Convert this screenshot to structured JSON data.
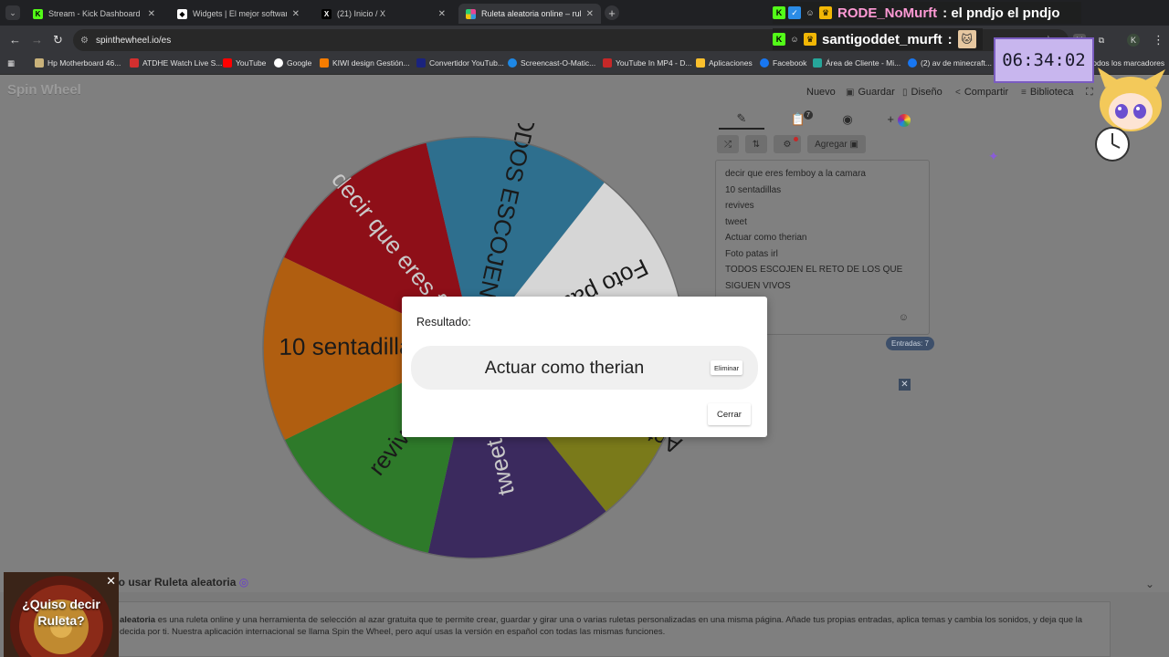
{
  "tabs": [
    {
      "title": "Stream - Kick Dashboard",
      "icon": "kick-icon",
      "badge": "K",
      "color": "#53fc18"
    },
    {
      "title": "Widgets | El mejor software para",
      "icon": "streamelements-icon",
      "badge": "◆",
      "color": "#ffffff"
    },
    {
      "title": "(21) Inicio / X",
      "icon": "x-icon",
      "badge": "X",
      "color": "#ffffff"
    },
    {
      "title": "Ruleta aleatoria online – ruleta",
      "icon": "spinthewheel-icon",
      "badge": "",
      "color": "#e84393"
    }
  ],
  "url": "spinthewheel.io/es",
  "bookmarks": [
    "Hp Motherboard 46...",
    "ATDHE Watch Live S...",
    "YouTube",
    "Google",
    "KIWI design Gestión...",
    "Convertidor YouTub...",
    "Screencast-O-Matic...",
    "YouTube In MP4 - D...",
    "Aplicaciones",
    "Facebook",
    "Área de Cliente - Mi...",
    "(2) av de minecraft...",
    "Todos los marcadores"
  ],
  "site": {
    "logo": "Spin Wheel",
    "nav": [
      {
        "label": "Nuevo",
        "icon": ""
      },
      {
        "label": "Guardar",
        "icon": "save-icon"
      },
      {
        "label": "Diseño",
        "icon": "paint-icon"
      },
      {
        "label": "Compartir",
        "icon": "share-icon"
      },
      {
        "label": "Biblioteca",
        "icon": "library-icon"
      }
    ]
  },
  "wheel": {
    "slices": [
      {
        "label": "decir que eres fe...",
        "color": "#8e0f18",
        "text_color": "#c9c9c9"
      },
      {
        "label": "TODOS ESCOJEN EL ...",
        "color": "#2e6f8e",
        "text_color": "#1a1a1a"
      },
      {
        "label": "Foto patas irl",
        "color": "#d6d6d6",
        "text_color": "#1a1a1a"
      },
      {
        "label": "Actuar como therian",
        "color": "#7a7a1a",
        "text_color": "#1a1a1a"
      },
      {
        "label": "tweet",
        "color": "#3b2a5e",
        "text_color": "#c9c9c9"
      },
      {
        "label": "revives",
        "color": "#2e7a2a",
        "text_color": "#1a1a1a"
      },
      {
        "label": "10 sentadillas",
        "color": "#b05e10",
        "text_color": "#1a1a1a"
      }
    ]
  },
  "panel": {
    "add_label": "Agregar",
    "entries": [
      "decir que eres femboy a la camara",
      "10 sentadillas",
      "revives",
      "tweet",
      "Actuar como therian",
      "Foto patas irl",
      "TODOS ESCOJEN EL RETO DE LOS QUE",
      "SIGUEN VIVOS"
    ],
    "count_label": "Entradas: 7",
    "notif_count": "7"
  },
  "dialog": {
    "title": "Resultado:",
    "result": "Actuar como therian",
    "delete_label": "Eliminar",
    "close_label": "Cerrar"
  },
  "overlay": {
    "timer": "06:34:02",
    "chat": [
      {
        "user": "RODE_NoMurft",
        "msg": ": el pndjo el pndjo",
        "user_color": "#ff9ad5"
      },
      {
        "user": "santigoddet_murft",
        "msg": ":",
        "user_color": "#ffffff"
      }
    ],
    "ad_text": "¿Quiso decir Ruleta?"
  },
  "footer": {
    "bold": "aleatoria",
    "text": " es una ruleta online y una herramienta de selección al azar gratuita que te permite crear, guardar y girar una o varias ruletas personalizadas en una misma página. Añade tus propias entradas, aplica temas y cambia los sonidos, y deja que la",
    "text2": "decida por ti. Nuestra aplicación internacional se llama Spin the Wheel, pero aquí usas la versión en español con todas las mismas funciones.",
    "heading": "Cómo usar Ruleta aleatoria"
  }
}
